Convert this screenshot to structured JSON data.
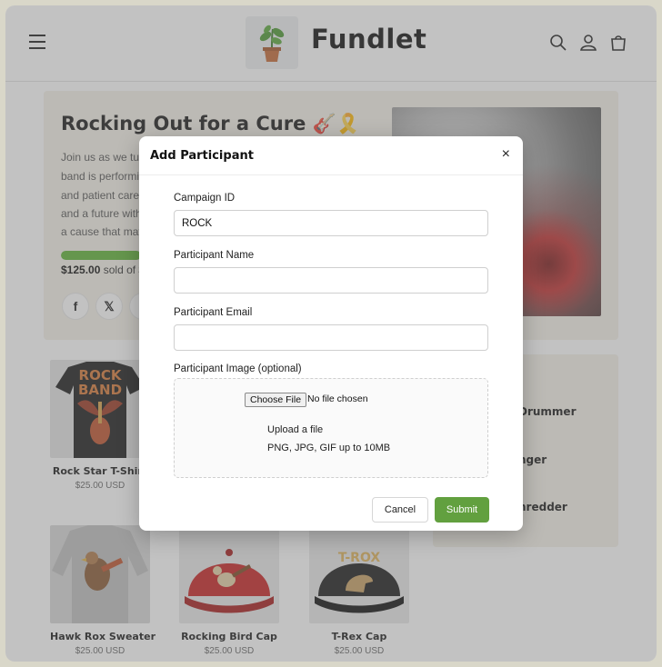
{
  "header": {
    "brand": "Fundlet"
  },
  "hero": {
    "title": "Rocking Out for a Cure 🎸🎗️",
    "description_lines": [
      "Join us as we tur",
      "band is performi",
      "and patient care,",
      "and a future with",
      "a cause that matt"
    ],
    "progress_fraction": 0.26,
    "raised_amount": "$125.00",
    "raised_suffix": "sold of $"
  },
  "social": {
    "facebook": "f",
    "x": "𝕏"
  },
  "products": [
    {
      "name": "Rock Star T-Shirt",
      "price": "$25.00 USD"
    },
    {
      "name": "Hawk Rox Sweater",
      "price": "$25.00 USD"
    },
    {
      "name": "Rocking Bird Cap",
      "price": "$25.00 USD"
    },
    {
      "name": "T-Rex Cap",
      "price": "$25.00 USD"
    }
  ],
  "product_print": {
    "tee_line1": "ROCK",
    "tee_line2": "BAND",
    "trex": "T-ROX"
  },
  "leaderboard": [
    "Drummer",
    "nger",
    "hredder"
  ],
  "modal": {
    "title": "Add Participant",
    "close": "×",
    "campaign_id_label": "Campaign ID",
    "campaign_id_value": "ROCK",
    "name_label": "Participant Name",
    "name_value": "",
    "email_label": "Participant Email",
    "email_value": "",
    "image_label": "Participant Image (optional)",
    "choose_file": "Choose File",
    "no_file": "No file chosen",
    "upload_text": "Upload a file",
    "upload_hint": "PNG, JPG, GIF up to 10MB",
    "cancel": "Cancel",
    "submit": "Submit"
  },
  "colors": {
    "accent_green": "#62a03f",
    "progress_green": "#5fb336"
  }
}
